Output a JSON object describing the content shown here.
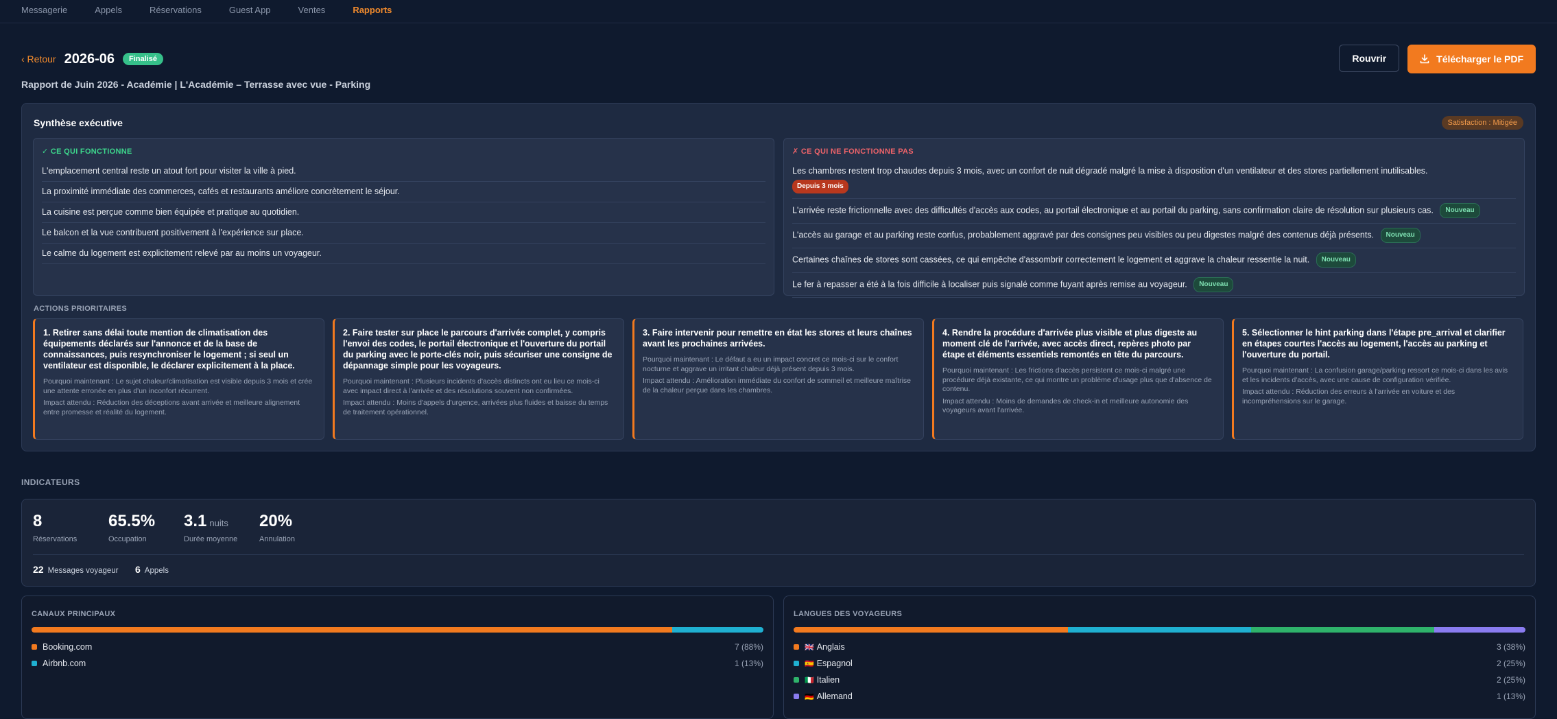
{
  "nav": {
    "items": [
      "Messagerie",
      "Appels",
      "Réservations",
      "Guest App",
      "Ventes",
      "Rapports"
    ],
    "active_index": 5
  },
  "header": {
    "back_label": "‹ Retour",
    "period": "2026-06",
    "status": "Finalisé",
    "reopen_label": "Rouvrir",
    "download_label": "Télécharger le PDF",
    "subtitle": "Rapport de Juin 2026 - Académie | L'Académie – Terrasse avec vue - Parking"
  },
  "summary": {
    "title": "Synthèse exécutive",
    "satisfaction": "Satisfaction : Mitigée",
    "works_title": "✓ CE QUI FONCTIONNE",
    "works": [
      "L'emplacement central reste un atout fort pour visiter la ville à pied.",
      "La proximité immédiate des commerces, cafés et restaurants améliore concrètement le séjour.",
      "La cuisine est perçue comme bien équipée et pratique au quotidien.",
      "Le balcon et la vue contribuent positivement à l'expérience sur place.",
      "Le calme du logement est explicitement relevé par au moins un voyageur."
    ],
    "fails_title": "✗ CE QUI NE FONCTIONNE PAS",
    "fails": [
      {
        "text": "Les chambres restent trop chaudes depuis 3 mois, avec un confort de nuit dégradé malgré la mise à disposition d'un ventilateur et des stores partiellement inutilisables.",
        "tag": "Depuis 3 mois"
      },
      {
        "text": "L'arrivée reste frictionnelle avec des difficultés d'accès aux codes, au portail électronique et au portail du parking, sans confirmation claire de résolution sur plusieurs cas.",
        "tag": "Nouveau"
      },
      {
        "text": "L'accès au garage et au parking reste confus, probablement aggravé par des consignes peu visibles ou peu digestes malgré des contenus déjà présents.",
        "tag": "Nouveau"
      },
      {
        "text": "Certaines chaînes de stores sont cassées, ce qui empêche d'assombrir correctement le logement et aggrave la chaleur ressentie la nuit.",
        "tag": "Nouveau"
      },
      {
        "text": "Le fer à repasser a été à la fois difficile à localiser puis signalé comme fuyant après remise au voyageur.",
        "tag": "Nouveau"
      }
    ]
  },
  "actions": {
    "title": "ACTIONS PRIORITAIRES",
    "items": [
      {
        "title": "1. Retirer sans délai toute mention de climatisation des équipements déclarés sur l'annonce et de la base de connaissances, puis resynchroniser le logement ; si seul un ventilateur est disponible, le déclarer explicitement à la place.",
        "why": "Pourquoi maintenant : Le sujet chaleur/climatisation est visible depuis 3 mois et crée une attente erronée en plus d'un inconfort récurrent.",
        "impact": "Impact attendu : Réduction des déceptions avant arrivée et meilleure alignement entre promesse et réalité du logement."
      },
      {
        "title": "2. Faire tester sur place le parcours d'arrivée complet, y compris l'envoi des codes, le portail électronique et l'ouverture du portail du parking avec le porte-clés noir, puis sécuriser une consigne de dépannage simple pour les voyageurs.",
        "why": "Pourquoi maintenant : Plusieurs incidents d'accès distincts ont eu lieu ce mois-ci avec impact direct à l'arrivée et des résolutions souvent non confirmées.",
        "impact": "Impact attendu : Moins d'appels d'urgence, arrivées plus fluides et baisse du temps de traitement opérationnel."
      },
      {
        "title": "3. Faire intervenir pour remettre en état les stores et leurs chaînes avant les prochaines arrivées.",
        "why": "Pourquoi maintenant : Le défaut a eu un impact concret ce mois-ci sur le confort nocturne et aggrave un irritant chaleur déjà présent depuis 3 mois.",
        "impact": "Impact attendu : Amélioration immédiate du confort de sommeil et meilleure maîtrise de la chaleur perçue dans les chambres."
      },
      {
        "title": "4. Rendre la procédure d'arrivée plus visible et plus digeste au moment clé de l'arrivée, avec accès direct, repères photo par étape et éléments essentiels remontés en tête du parcours.",
        "why": "Pourquoi maintenant : Les frictions d'accès persistent ce mois-ci malgré une procédure déjà existante, ce qui montre un problème d'usage plus que d'absence de contenu.",
        "impact": "Impact attendu : Moins de demandes de check-in et meilleure autonomie des voyageurs avant l'arrivée."
      },
      {
        "title": "5. Sélectionner le hint parking dans l'étape pre_arrival et clarifier en étapes courtes l'accès au logement, l'accès au parking et l'ouverture du portail.",
        "why": "Pourquoi maintenant : La confusion garage/parking ressort ce mois-ci dans les avis et les incidents d'accès, avec une cause de configuration vérifiée.",
        "impact": "Impact attendu : Réduction des erreurs à l'arrivée en voiture et des incompréhensions sur le garage."
      }
    ]
  },
  "indicators": {
    "title": "INDICATEURS",
    "kpis": [
      {
        "value": "8",
        "unit": "",
        "label": "Réservations"
      },
      {
        "value": "65.5%",
        "unit": "",
        "label": "Occupation"
      },
      {
        "value": "3.1",
        "unit": "nuits",
        "label": "Durée moyenne"
      },
      {
        "value": "20%",
        "unit": "",
        "label": "Annulation"
      }
    ],
    "messages_count": "22",
    "messages_label": "Messages voyageur",
    "calls_count": "6",
    "calls_label": "Appels"
  },
  "channels": {
    "title": "CANAUX PRINCIPAUX",
    "items": [
      {
        "name": "Booking.com",
        "value": "7 (88%)",
        "share": 0.875,
        "color": "#f27a1f"
      },
      {
        "name": "Airbnb.com",
        "value": "1 (13%)",
        "share": 0.125,
        "color": "#1fb0d1"
      }
    ]
  },
  "languages": {
    "title": "LANGUES DES VOYAGEURS",
    "items": [
      {
        "name": "Anglais",
        "flag": "🇬🇧",
        "value": "3 (38%)",
        "share": 0.375,
        "color": "#f27a1f"
      },
      {
        "name": "Espagnol",
        "flag": "🇪🇸",
        "value": "2 (25%)",
        "share": 0.25,
        "color": "#1fb0d1"
      },
      {
        "name": "Italien",
        "flag": "🇮🇹",
        "value": "2 (25%)",
        "share": 0.25,
        "color": "#2fb36b"
      },
      {
        "name": "Allemand",
        "flag": "🇩🇪",
        "value": "1 (13%)",
        "share": 0.125,
        "color": "#8a7cf0"
      }
    ]
  }
}
